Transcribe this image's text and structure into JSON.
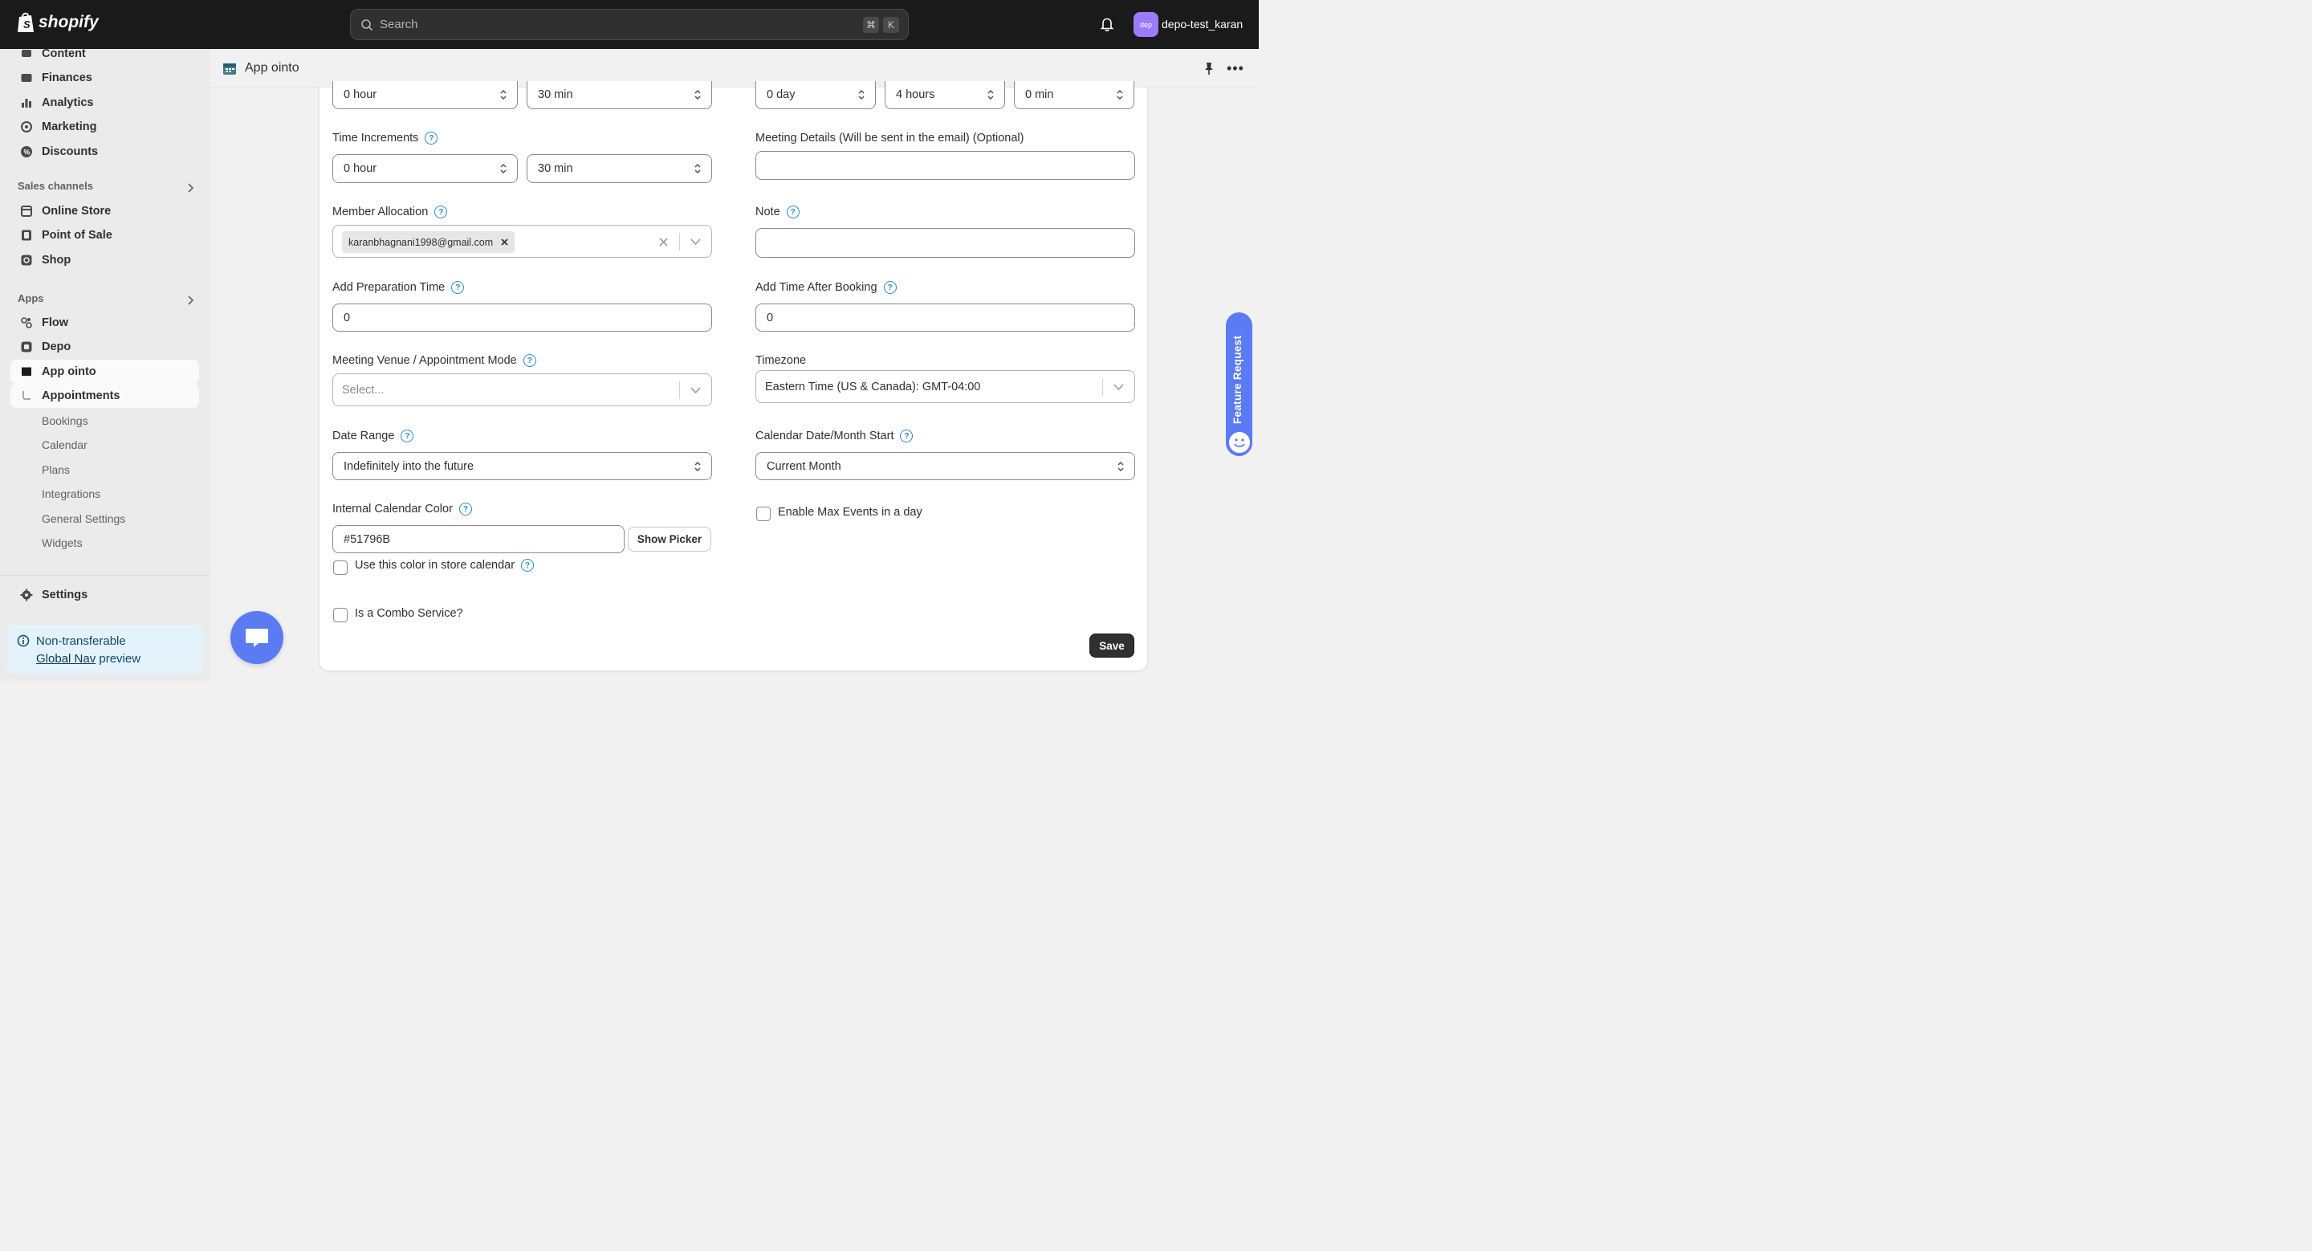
{
  "topbar": {
    "brand": "shopify",
    "search_placeholder": "Search",
    "shortcut_cmd": "⌘",
    "shortcut_key": "K",
    "avatar_initials": "dep",
    "store_name": "depo-test_karan"
  },
  "sidebar": {
    "items_top": [
      {
        "label": "Content",
        "icon": "content-icon"
      },
      {
        "label": "Finances",
        "icon": "finances-icon"
      },
      {
        "label": "Analytics",
        "icon": "analytics-icon"
      },
      {
        "label": "Marketing",
        "icon": "marketing-icon"
      },
      {
        "label": "Discounts",
        "icon": "discounts-icon"
      }
    ],
    "sales_channels_label": "Sales channels",
    "sales_channels": [
      {
        "label": "Online Store",
        "icon": "store-icon"
      },
      {
        "label": "Point of Sale",
        "icon": "pos-icon"
      },
      {
        "label": "Shop",
        "icon": "shop-icon"
      }
    ],
    "apps_label": "Apps",
    "apps": [
      {
        "label": "Flow",
        "icon": "flow-icon"
      },
      {
        "label": "Depo",
        "icon": "depo-icon"
      },
      {
        "label": "App ointo",
        "icon": "app-icon"
      }
    ],
    "sub_active": "Appointments",
    "sub_items": [
      "Bookings",
      "Calendar",
      "Plans",
      "Integrations",
      "General Settings",
      "Widgets"
    ],
    "settings_label": "Settings",
    "preview_line1": "Non-transferable",
    "preview_link": "Global Nav",
    "preview_line2": "preview"
  },
  "header": {
    "title": "App ointo"
  },
  "form": {
    "duration_hour": "0 hour",
    "duration_min": "30 min",
    "buffer_day": "0 day",
    "buffer_hours": "4 hours",
    "buffer_min": "0 min",
    "time_increments_label": "Time Increments",
    "time_increments_hour": "0 hour",
    "time_increments_min": "30 min",
    "meeting_details_label": "Meeting Details (Will be sent in the email) (Optional)",
    "meeting_details_value": "",
    "member_allocation_label": "Member Allocation",
    "member_chip": "karanbhagnani1998@gmail.com",
    "note_label": "Note",
    "note_value": "",
    "prep_time_label": "Add Preparation Time",
    "prep_time_value": "0",
    "after_booking_label": "Add Time After Booking",
    "after_booking_value": "0",
    "venue_label": "Meeting Venue / Appointment Mode",
    "venue_placeholder": "Select...",
    "timezone_label": "Timezone",
    "timezone_value": "Eastern Time (US & Canada): GMT-04:00",
    "date_range_label": "Date Range",
    "date_range_value": "Indefinitely into the future",
    "calendar_start_label": "Calendar Date/Month Start",
    "calendar_start_value": "Current Month",
    "calendar_color_label": "Internal Calendar Color",
    "calendar_color_value": "#51796B",
    "show_picker_label": "Show Picker",
    "use_color_label": "Use this color in store calendar",
    "max_events_label": "Enable Max Events in a day",
    "combo_label": "Is a Combo Service?",
    "save_label": "Save"
  },
  "feature_request_label": "Feature Request",
  "colors": {
    "accent": "#5b7bf4",
    "help": "#2c8ac4"
  }
}
